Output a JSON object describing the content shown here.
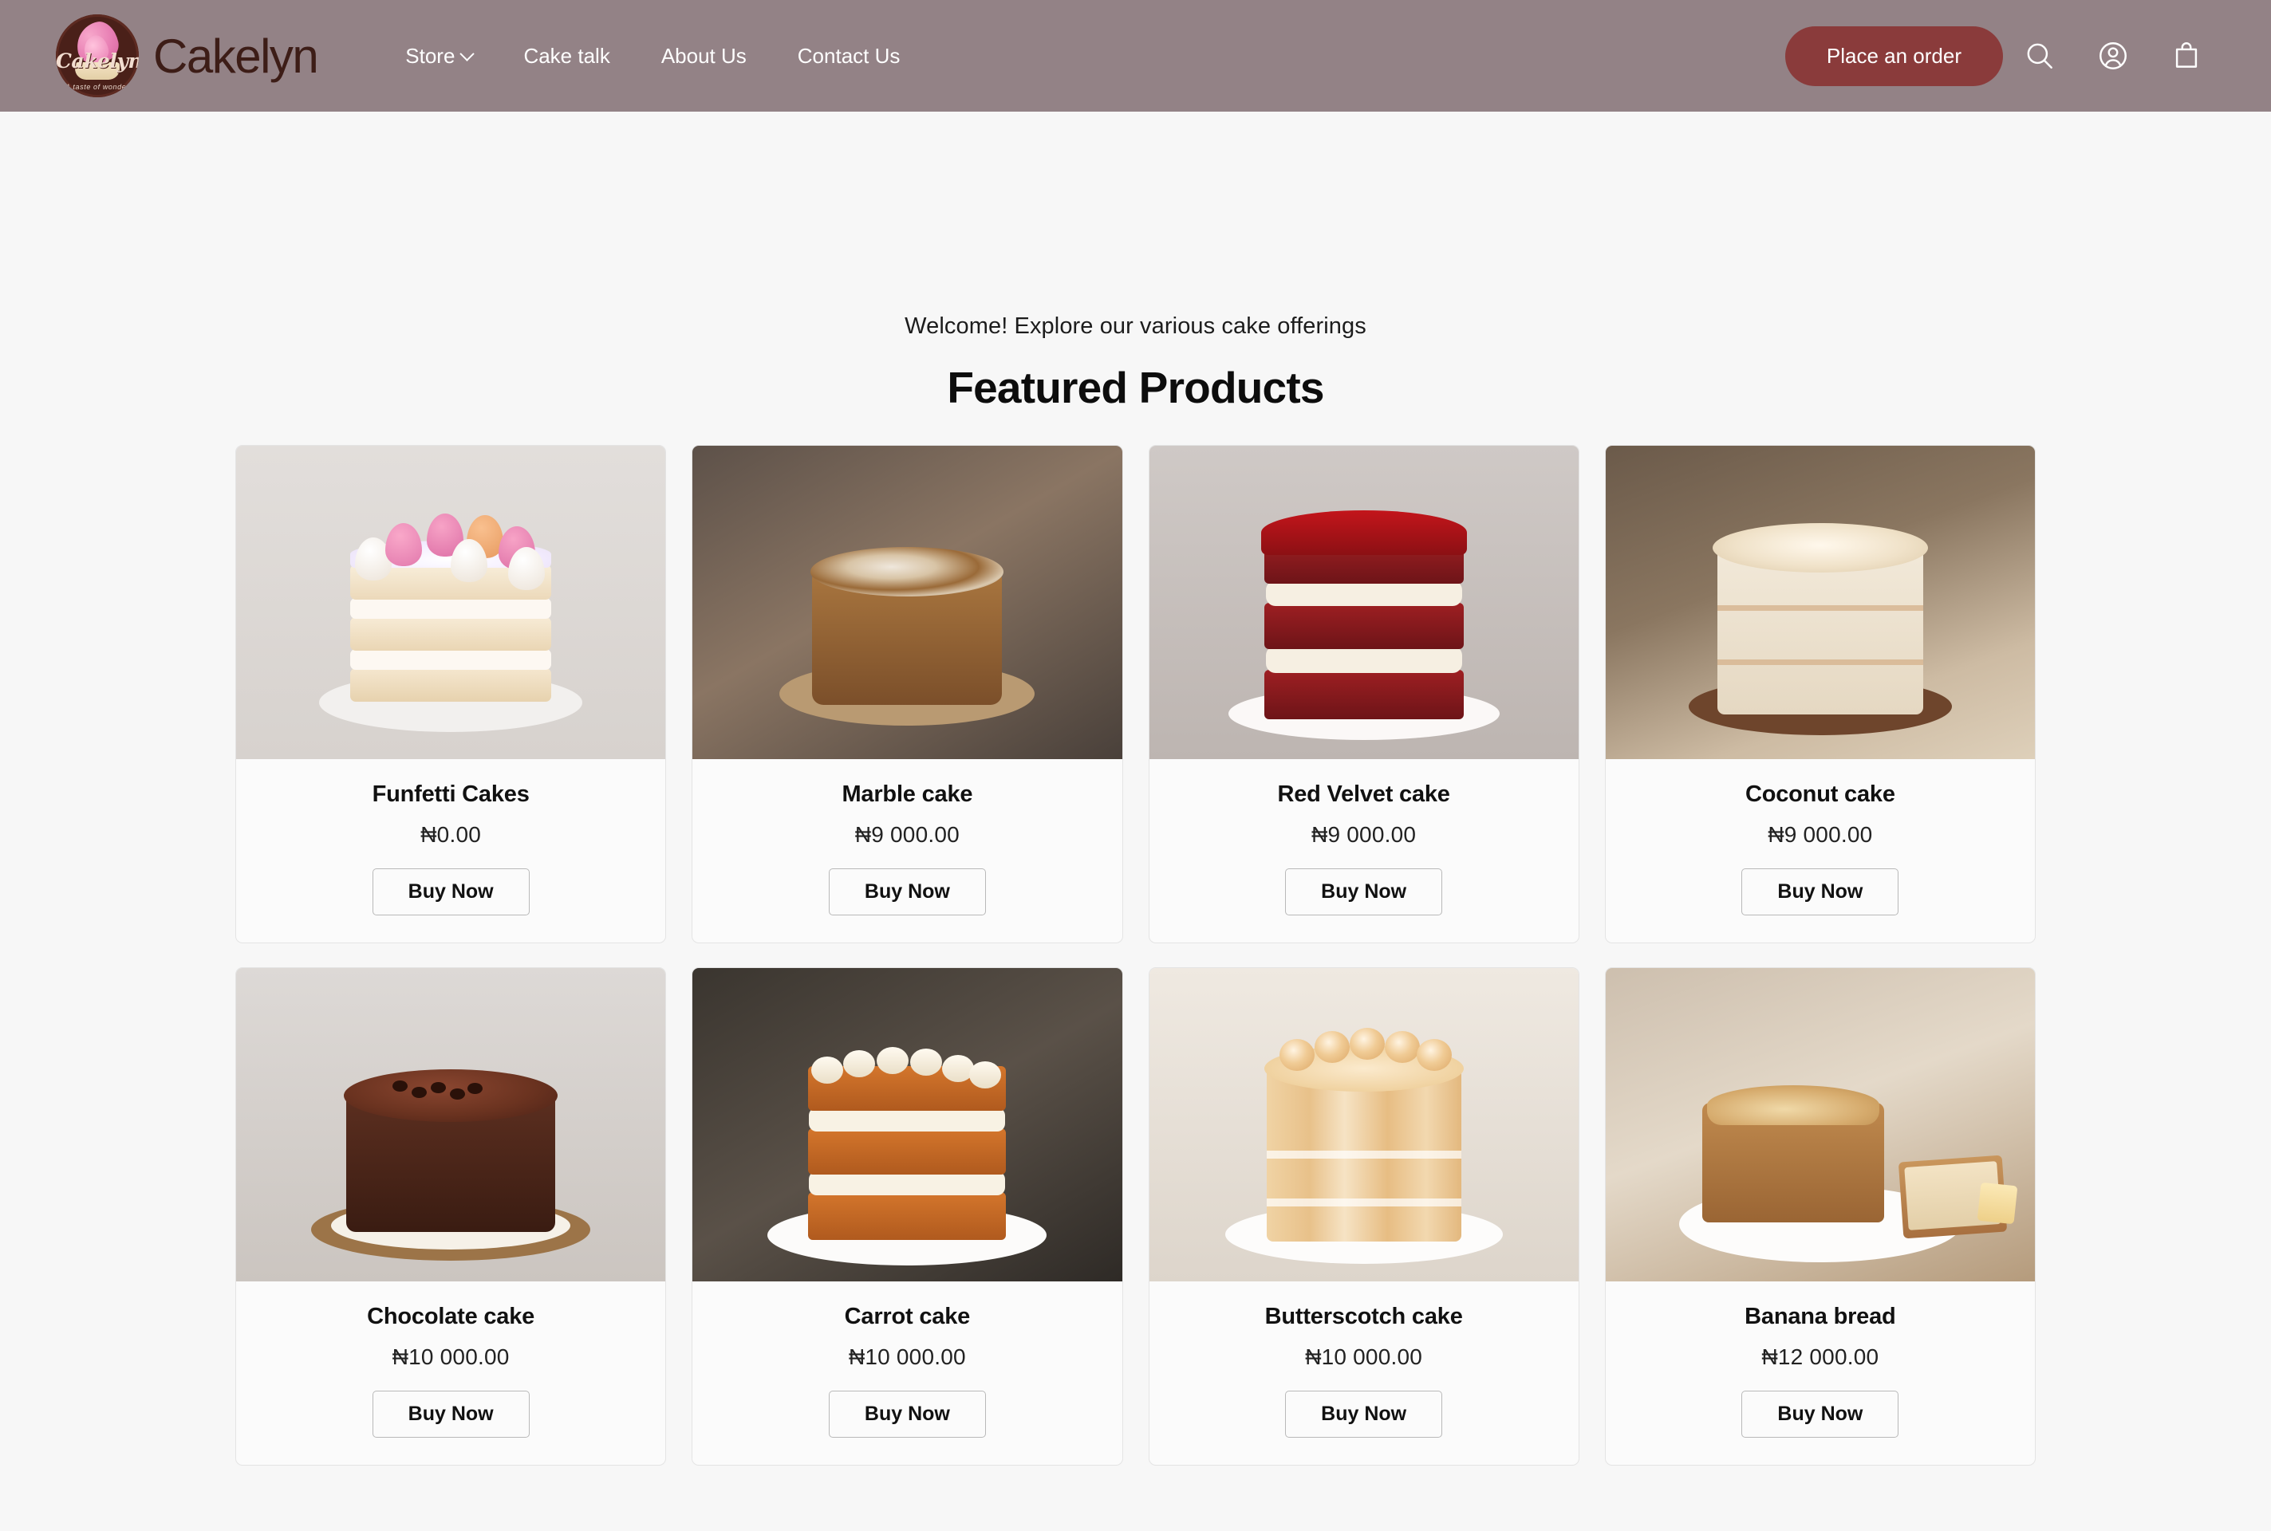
{
  "header": {
    "brand_name": "Cakelyn",
    "logo": {
      "script_text": "Cakelyn",
      "tagline": "A taste of wonder"
    },
    "nav": [
      {
        "label": "Store",
        "has_dropdown": true
      },
      {
        "label": "Cake talk",
        "has_dropdown": false
      },
      {
        "label": "About Us",
        "has_dropdown": false
      },
      {
        "label": "Contact Us",
        "has_dropdown": false
      }
    ],
    "cta_label": "Place an order",
    "icons": [
      "search-icon",
      "account-icon",
      "cart-icon"
    ],
    "colors": {
      "background": "#938286",
      "cta_background": "#8a3b3b",
      "nav_text": "#ffffff",
      "brand_text": "#3d1d17"
    }
  },
  "main": {
    "welcome_text": "Welcome! Explore our various cake offerings",
    "section_title": "Featured Products",
    "buy_label": "Buy Now",
    "products": [
      {
        "name": "Funfetti Cakes",
        "price": "₦0.00",
        "art": "funfetti"
      },
      {
        "name": "Marble cake",
        "price": "₦9 000.00",
        "art": "marble"
      },
      {
        "name": "Red Velvet cake",
        "price": "₦9 000.00",
        "art": "velvet"
      },
      {
        "name": "Coconut cake",
        "price": "₦9 000.00",
        "art": "coconut"
      },
      {
        "name": "Chocolate cake",
        "price": "₦10 000.00",
        "art": "choc"
      },
      {
        "name": "Carrot cake",
        "price": "₦10 000.00",
        "art": "carrot"
      },
      {
        "name": "Butterscotch cake",
        "price": "₦10 000.00",
        "art": "butter"
      },
      {
        "name": "Banana bread",
        "price": "₦12 000.00",
        "art": "banana"
      }
    ],
    "colors": {
      "page_background": "#f7f7f7",
      "card_background": "#fbfbfb",
      "card_border": "#e4e4e4",
      "title_text": "#0d0d0d"
    }
  }
}
